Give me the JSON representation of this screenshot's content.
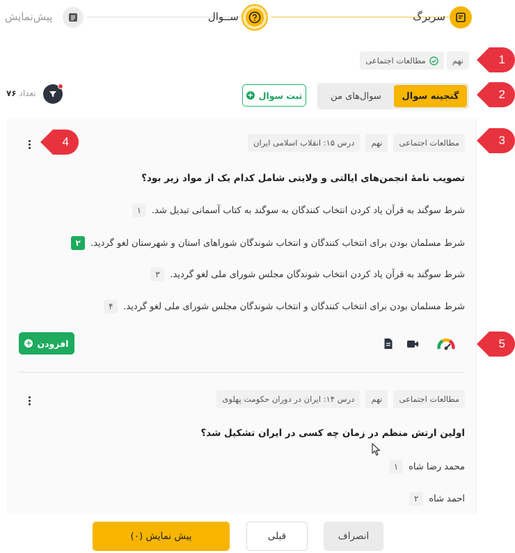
{
  "stepper": {
    "steps": [
      {
        "label": "سربرگ",
        "state": "done",
        "icon": "document-icon"
      },
      {
        "label": "ســوال",
        "state": "current",
        "icon": "question-icon"
      },
      {
        "label": "پیش‌نمایش",
        "state": "todo",
        "icon": "list-icon"
      }
    ]
  },
  "filters": {
    "tags": [
      "نهم",
      "مطالعات اجتماعی"
    ],
    "subject_icon": "check-circle-icon"
  },
  "toolbar": {
    "tabs": [
      {
        "label": "گنجینه سوال",
        "active": true
      },
      {
        "label": "سوال‌های من",
        "active": false
      }
    ],
    "register_label": "ثبت سوال",
    "count_label": "تعداد",
    "count_value": "۷۶"
  },
  "markers": [
    "1",
    "2",
    "3",
    "4",
    "5"
  ],
  "questions": [
    {
      "tags": [
        "مطالعات اجتماعی",
        "نهم",
        "درس ۱۵: انقلاب اسلامی ایران"
      ],
      "text": "تصویب نامهٔ انجمن‌های ایالتی و ولایتی شامل کدام یک از مواد زیر بود؟",
      "options": [
        {
          "num": "۱",
          "text": "شرط سوگند به قرآن یاد کردن انتخاب کنندگان به سوگند به کتاب آسمانی تبدیل شد.",
          "correct": false
        },
        {
          "num": "۲",
          "text": "شرط مسلمان بودن برای انتخاب کنندگان و انتخاب شوندگان شوراهای استان و شهرستان لغو گردید.",
          "correct": true
        },
        {
          "num": "۳",
          "text": "شرط سوگند به قرآن یاد کردن انتخاب شوندگان مجلس شورای ملی لغو گردید.",
          "correct": false
        },
        {
          "num": "۴",
          "text": "شرط مسلمان بودن برای انتخاب کنندگان و انتخاب شوندگان مجلس شورای ملی لغو گردید.",
          "correct": false
        }
      ],
      "add_label": "افزودن",
      "action_icons": [
        "difficulty-gauge-icon",
        "video-icon",
        "document-icon"
      ]
    },
    {
      "tags": [
        "مطالعات اجتماعی",
        "نهم",
        "درس ۱۴: ایران در دوران حکومت پهلوی"
      ],
      "text": "اولین ارتش منظم در زمان چه کسی در ایران تشکیل شد؟",
      "options": [
        {
          "num": "۱",
          "text": "محمد رضا شاه",
          "correct": false
        },
        {
          "num": "۲",
          "text": "احمد شاه",
          "correct": false
        }
      ]
    }
  ],
  "footer": {
    "cancel_label": "انصراف",
    "prev_label": "قبلی",
    "preview_label": "پیش نمایش (۰)"
  },
  "colors": {
    "accent": "#f7b500",
    "success": "#1eab5e",
    "marker": "#e8333f",
    "dark": "#2d3440"
  }
}
